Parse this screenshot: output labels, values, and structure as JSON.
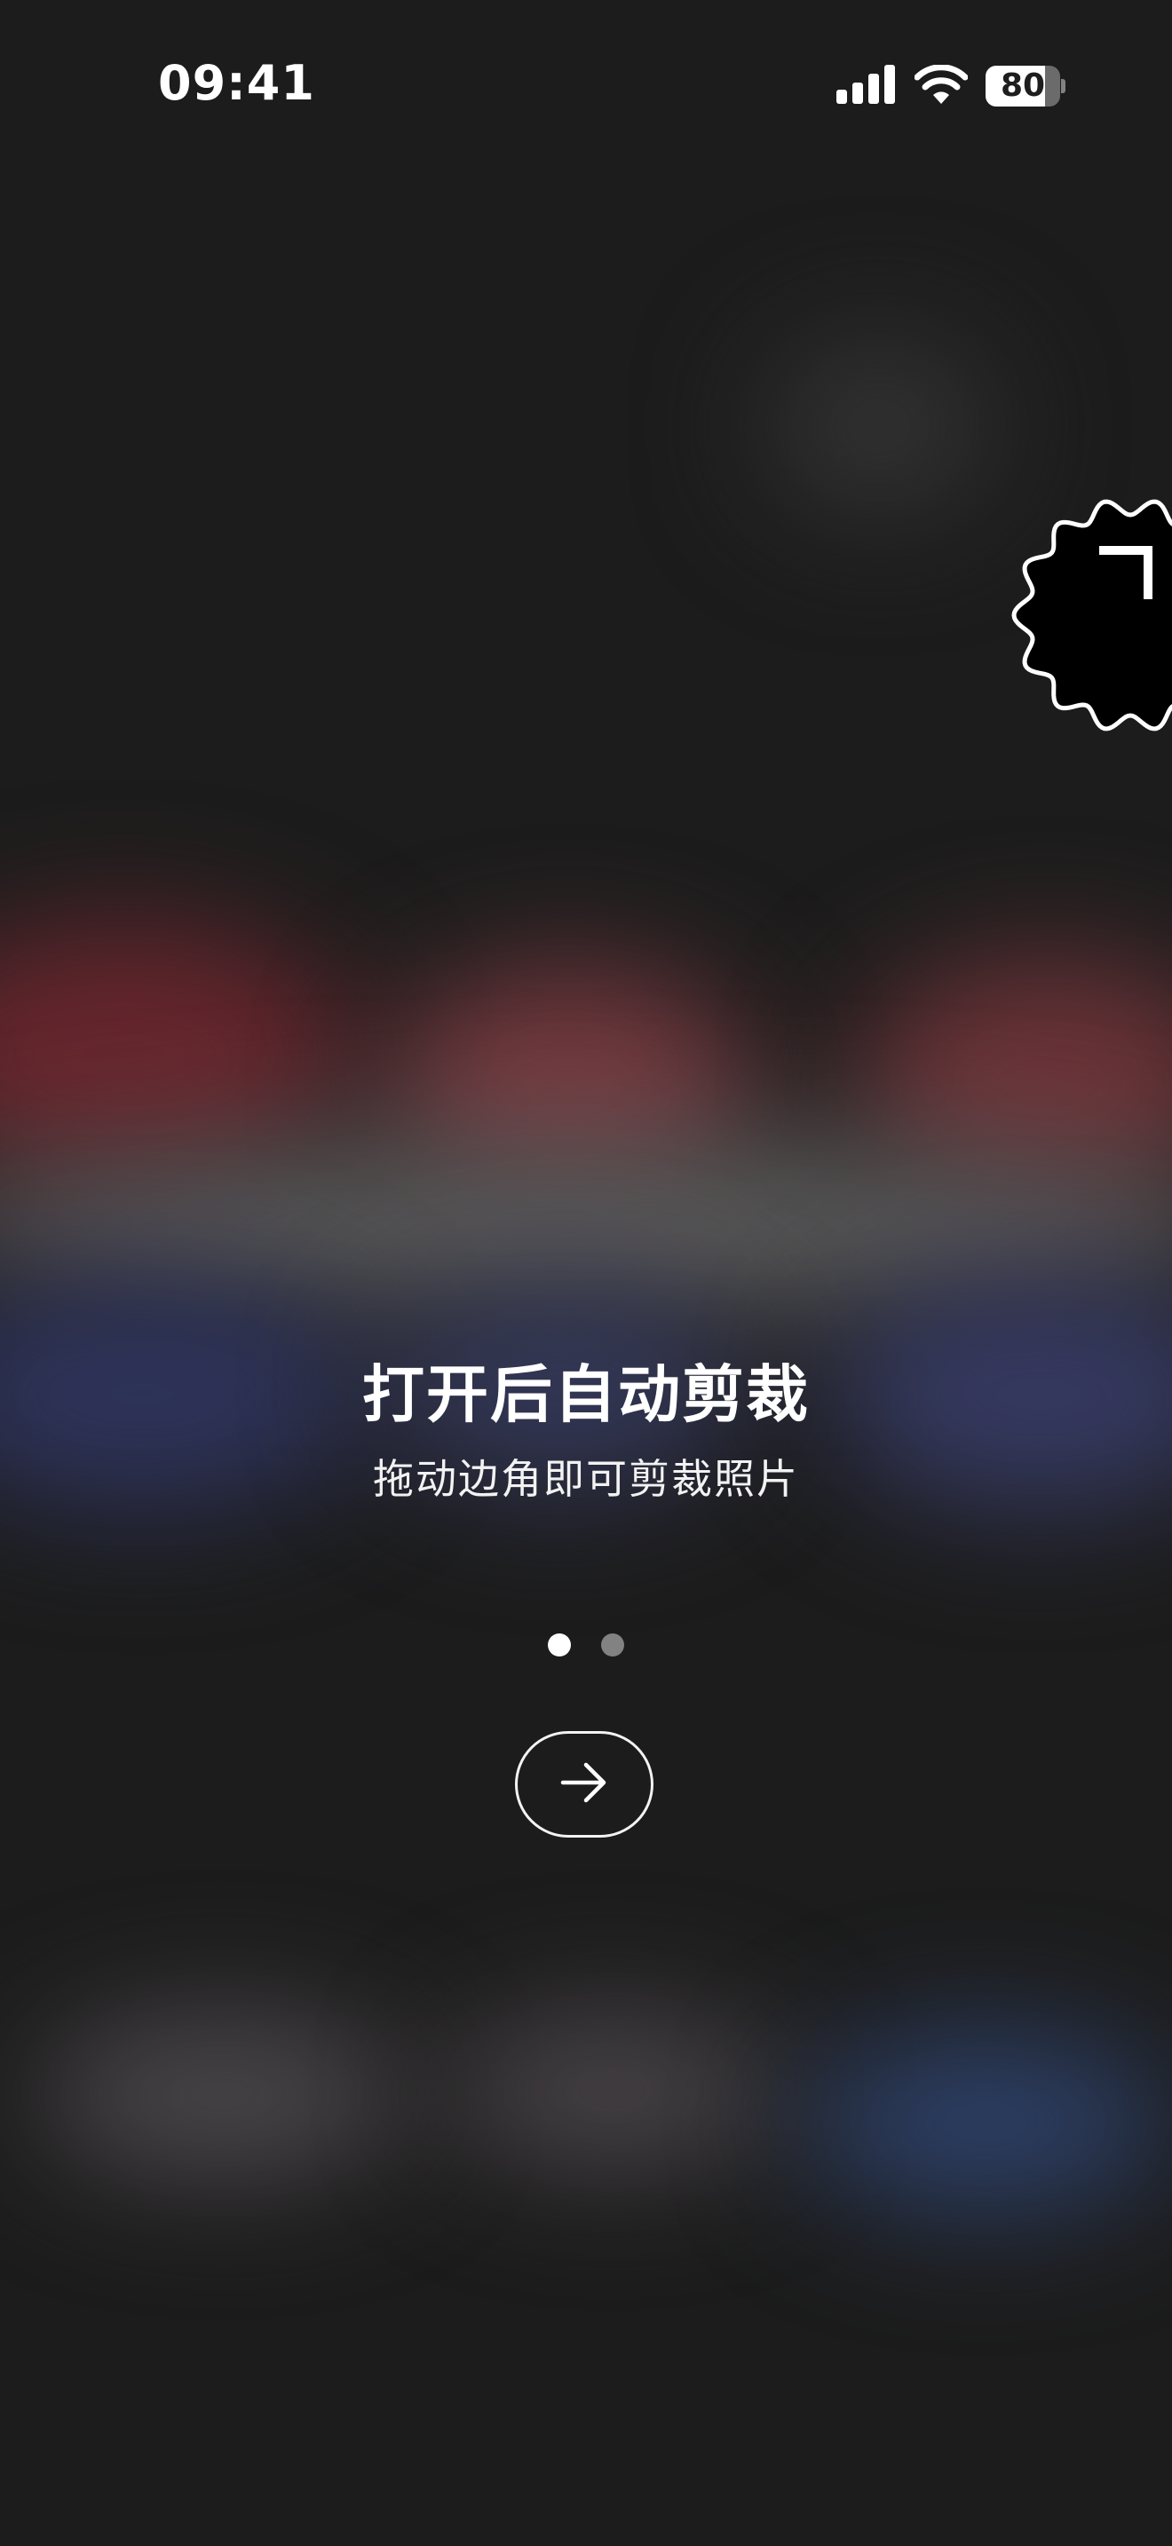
{
  "status_bar": {
    "time": "09:41",
    "battery_level": "80",
    "battery_fraction": 0.8,
    "icons": [
      "cellular-signal-icon",
      "wifi-icon",
      "battery-charging-icon"
    ]
  },
  "onboarding": {
    "title": "打开后自动剪裁",
    "subtitle": "拖动边角即可剪裁照片",
    "page_indicator": {
      "current": 1,
      "total": 2
    },
    "next_button_icon": "arrow-right-icon"
  },
  "crop_badge_icon": "crop-corner-icon",
  "colors": {
    "background": "#1e1e1e",
    "text": "#ffffff",
    "dot_inactive": "#8a8a8a",
    "badge_fill": "#000000"
  }
}
